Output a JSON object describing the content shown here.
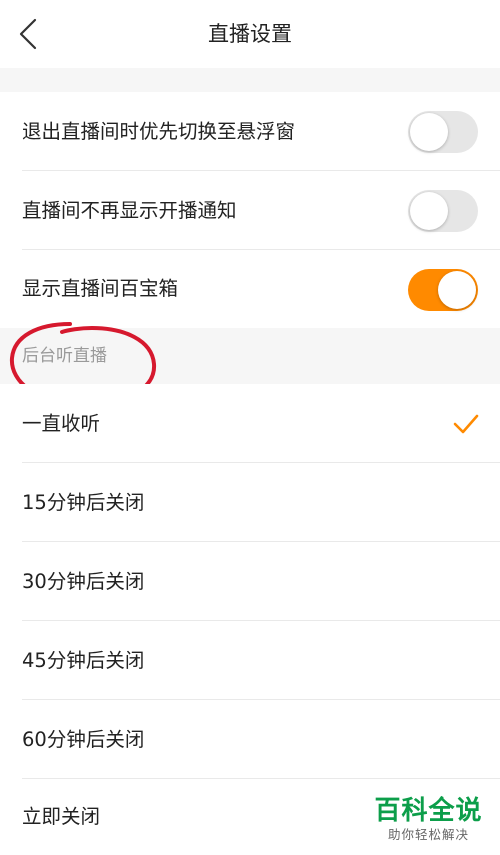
{
  "header": {
    "title": "直播设置"
  },
  "settings": [
    {
      "label": "退出直播间时优先切换至悬浮窗",
      "enabled": false
    },
    {
      "label": "直播间不再显示开播通知",
      "enabled": false
    },
    {
      "label": "显示直播间百宝箱",
      "enabled": true
    }
  ],
  "background_listen": {
    "section_title": "后台听直播",
    "options": [
      {
        "label": "一直收听",
        "selected": true
      },
      {
        "label": "15分钟后关闭",
        "selected": false
      },
      {
        "label": "30分钟后关闭",
        "selected": false
      },
      {
        "label": "45分钟后关闭",
        "selected": false
      },
      {
        "label": "60分钟后关闭",
        "selected": false
      },
      {
        "label": "立即关闭",
        "selected": false
      }
    ]
  },
  "watermark": {
    "main": "百科全说",
    "sub": "助你轻松解决"
  },
  "colors": {
    "accent": "#ff8a00",
    "annotation": "#d6192e",
    "watermark": "#0c9e4a"
  },
  "icons": {
    "back": "chevron-left-icon",
    "check": "checkmark-icon"
  }
}
